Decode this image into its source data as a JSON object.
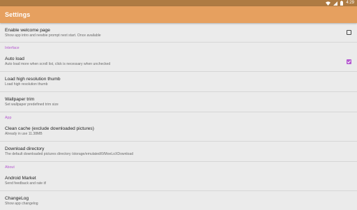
{
  "status": {
    "time": "4:29",
    "wifi_icon": "wifi-icon",
    "signal_icon": "signal-icon",
    "battery_icon": "battery-icon"
  },
  "appbar": {
    "title": "Settings"
  },
  "welcome": {
    "title": "Enable welcome page",
    "summary": "Show app intro and newbie prompt next start. Once available",
    "checked": false
  },
  "sections": {
    "interface": "Interface",
    "app": "App",
    "about": "About"
  },
  "interface": {
    "autoload": {
      "title": "Auto load",
      "summary": "Auto load more when scroll list, click is necessary when unchecked",
      "checked": true
    },
    "hires": {
      "title": "Load high resolution thumb",
      "summary": "Load high resolution thumb"
    },
    "trim": {
      "title": "Wallpaper trim",
      "summary": "Set wallpaper predefined trim size"
    }
  },
  "app": {
    "cache": {
      "title": "Clean cache (exclude downloaded pictures)",
      "summary": "Already in use 11.38MB"
    },
    "download": {
      "title": "Download directory",
      "summary": "The default downloaded pictures directory /storage/emulated/0/MoeLoXDownload"
    }
  },
  "about": {
    "market": {
      "title": "Android Market",
      "summary": "Send feedback and rate it!"
    },
    "changelog": {
      "title": "ChangeLog",
      "summary": "Show app changelog"
    }
  },
  "colors": {
    "statusbar": "#ae7b43",
    "appbar": "#e6a05f",
    "accent": "#b55ad0",
    "background": "#ebebeb"
  }
}
